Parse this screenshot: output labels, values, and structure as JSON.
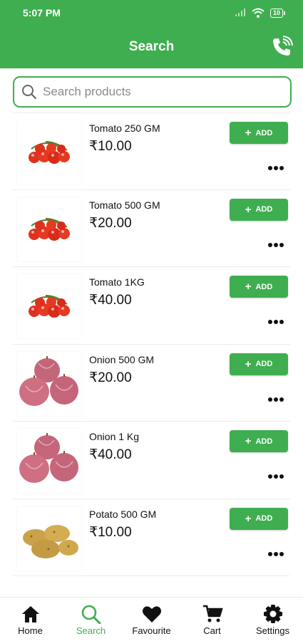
{
  "status_bar": {
    "time": "5:07 PM",
    "battery": "10"
  },
  "app_bar": {
    "title": "Search"
  },
  "search": {
    "placeholder": "Search products"
  },
  "products": [
    {
      "name": "Tomato 250 GM",
      "price": "₹10.00",
      "add_label": "ADD",
      "image": "tomato"
    },
    {
      "name": "Tomato 500 GM",
      "price": "₹20.00",
      "add_label": "ADD",
      "image": "tomato"
    },
    {
      "name": "Tomato 1KG",
      "price": "₹40.00",
      "add_label": "ADD",
      "image": "tomato"
    },
    {
      "name": "Onion 500 GM",
      "price": "₹20.00",
      "add_label": "ADD",
      "image": "onion"
    },
    {
      "name": "Onion 1 Kg",
      "price": "₹40.00",
      "add_label": "ADD",
      "image": "onion"
    },
    {
      "name": "Potato 500 GM",
      "price": "₹10.00",
      "add_label": "ADD",
      "image": "potato"
    }
  ],
  "bottom_nav": [
    {
      "label": "Home",
      "icon": "home-icon"
    },
    {
      "label": "Search",
      "icon": "search-icon",
      "active": true
    },
    {
      "label": "Favourite",
      "icon": "heart-icon"
    },
    {
      "label": "Cart",
      "icon": "cart-icon"
    },
    {
      "label": "Settings",
      "icon": "gear-icon"
    }
  ],
  "colors": {
    "primary": "#3fae50",
    "text": "#111111"
  }
}
